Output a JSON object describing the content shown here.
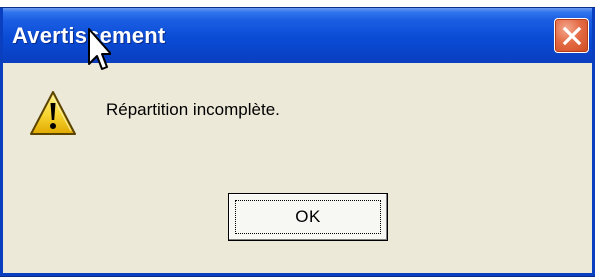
{
  "dialog": {
    "title": "Avertissement",
    "message": "Répartition incomplète.",
    "icon": "warning-triangle-icon",
    "close_icon": "close-icon"
  },
  "buttons": {
    "ok_label": "OK"
  },
  "colors": {
    "titlebar": "#0b4cd6",
    "close_button": "#e0522a",
    "dialog_background": "#ece9d8",
    "warning_yellow": "#f7d430"
  }
}
